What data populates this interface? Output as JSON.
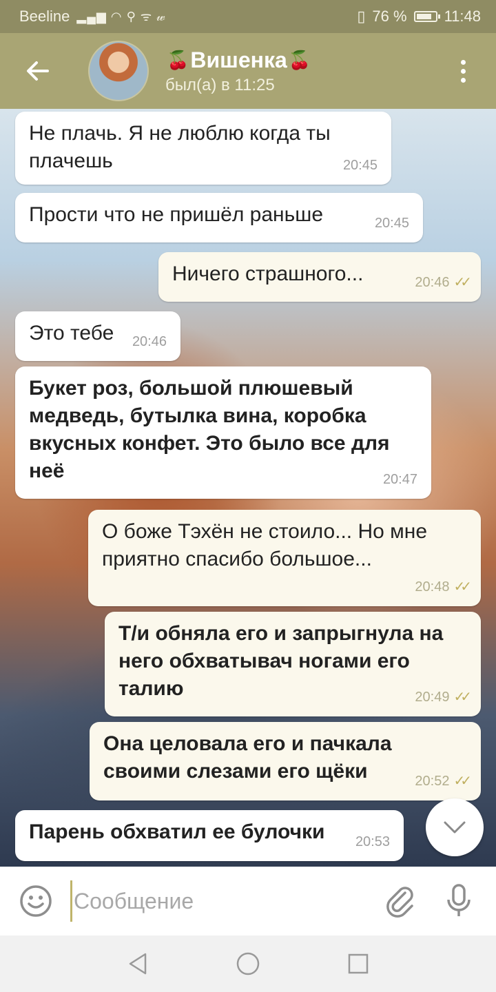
{
  "statusbar": {
    "carrier": "Beeline",
    "icons": [
      "signal-icon",
      "wifi-icon",
      "search-icon",
      "rss-icon",
      "w-icon"
    ],
    "battery_percent": "76 %",
    "time": "11:48"
  },
  "header": {
    "back_icon": "arrow-left-icon",
    "title": "Вишенка",
    "title_decoration": "🍒",
    "status": "был(а) в 11:25",
    "menu_icon": "more-vert-icon"
  },
  "messages": [
    {
      "direction": "in",
      "bold": false,
      "text": "Не плачь. Я не люблю когда ты плачешь",
      "time": "20:45",
      "read": false
    },
    {
      "direction": "in",
      "bold": false,
      "text": "Прости что не пришёл раньше",
      "time": "20:45",
      "read": false
    },
    {
      "direction": "out",
      "bold": false,
      "text": "Ничего страшного...",
      "time": "20:46",
      "read": true
    },
    {
      "direction": "in",
      "bold": false,
      "text": "Это тебе",
      "time": "20:46",
      "read": false
    },
    {
      "direction": "in",
      "bold": true,
      "text": "Букет роз, большой плюшевый медведь, бутылка вина, коробка вкусных конфет. Это было все для неё",
      "time": "20:47",
      "read": false
    },
    {
      "direction": "out",
      "bold": false,
      "text": "О боже Тэхён не стоило... Но мне приятно спасибо большое...",
      "time": "20:48",
      "read": true
    },
    {
      "direction": "out",
      "bold": true,
      "text": "Т/и обняла его и запрыгнула на него обхватывач ногами его талию",
      "time": "20:49",
      "read": true
    },
    {
      "direction": "out",
      "bold": true,
      "text": "Она целовала его и пачкала своими слезами его щёки",
      "time": "20:52",
      "read": true
    },
    {
      "direction": "in",
      "bold": true,
      "text": "Парень обхватил ее булочки",
      "time": "20:53",
      "read": false
    }
  ],
  "read_checks": "✓✓",
  "scroll_icon": "chevron-down-icon",
  "input": {
    "placeholder": "Сообщение",
    "emoji_icon": "emoji-icon",
    "attach_icon": "paperclip-icon",
    "mic_icon": "microphone-icon"
  },
  "navbar": {
    "icons": [
      "back-triangle-icon",
      "home-circle-icon",
      "recents-square-icon"
    ]
  },
  "colors": {
    "header_bg": "#a9a574",
    "statusbar_bg": "#8f8c63",
    "incoming_bubble": "#ffffff",
    "outgoing_bubble": "#fbf8ec",
    "read_check": "#c0b060"
  }
}
